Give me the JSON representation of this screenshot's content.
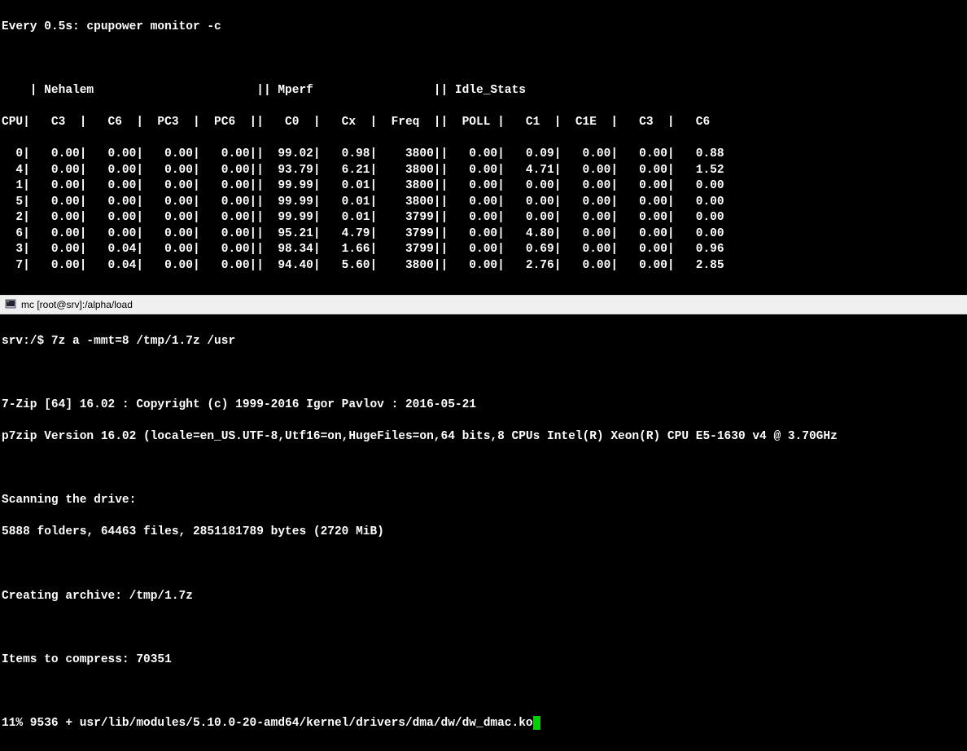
{
  "top": {
    "watch_line": "Every 0.5s: cpupower monitor -c",
    "groups": [
      "Nehalem",
      "Mperf",
      "Idle_Stats"
    ],
    "headers": [
      "CPU",
      "C3",
      "C6",
      "PC3",
      "PC6",
      "C0",
      "Cx",
      "Freq",
      "POLL",
      "C1",
      "C1E",
      "C3",
      "C6"
    ],
    "rows": [
      {
        "cpu": "0",
        "c3": "0.00",
        "c6": "0.00",
        "pc3": "0.00",
        "pc6": "0.00",
        "c0": "99.02",
        "cx": "0.98",
        "freq": "3800",
        "poll": "0.00",
        "c1": "0.09",
        "c1e": "0.00",
        "ic3": "0.00",
        "ic6": "0.88"
      },
      {
        "cpu": "4",
        "c3": "0.00",
        "c6": "0.00",
        "pc3": "0.00",
        "pc6": "0.00",
        "c0": "93.79",
        "cx": "6.21",
        "freq": "3800",
        "poll": "0.00",
        "c1": "4.71",
        "c1e": "0.00",
        "ic3": "0.00",
        "ic6": "1.52"
      },
      {
        "cpu": "1",
        "c3": "0.00",
        "c6": "0.00",
        "pc3": "0.00",
        "pc6": "0.00",
        "c0": "99.99",
        "cx": "0.01",
        "freq": "3800",
        "poll": "0.00",
        "c1": "0.00",
        "c1e": "0.00",
        "ic3": "0.00",
        "ic6": "0.00"
      },
      {
        "cpu": "5",
        "c3": "0.00",
        "c6": "0.00",
        "pc3": "0.00",
        "pc6": "0.00",
        "c0": "99.99",
        "cx": "0.01",
        "freq": "3800",
        "poll": "0.00",
        "c1": "0.00",
        "c1e": "0.00",
        "ic3": "0.00",
        "ic6": "0.00"
      },
      {
        "cpu": "2",
        "c3": "0.00",
        "c6": "0.00",
        "pc3": "0.00",
        "pc6": "0.00",
        "c0": "99.99",
        "cx": "0.01",
        "freq": "3799",
        "poll": "0.00",
        "c1": "0.00",
        "c1e": "0.00",
        "ic3": "0.00",
        "ic6": "0.00"
      },
      {
        "cpu": "6",
        "c3": "0.00",
        "c6": "0.00",
        "pc3": "0.00",
        "pc6": "0.00",
        "c0": "95.21",
        "cx": "4.79",
        "freq": "3799",
        "poll": "0.00",
        "c1": "4.80",
        "c1e": "0.00",
        "ic3": "0.00",
        "ic6": "0.00"
      },
      {
        "cpu": "3",
        "c3": "0.00",
        "c6": "0.04",
        "pc3": "0.00",
        "pc6": "0.00",
        "c0": "98.34",
        "cx": "1.66",
        "freq": "3799",
        "poll": "0.00",
        "c1": "0.69",
        "c1e": "0.00",
        "ic3": "0.00",
        "ic6": "0.96"
      },
      {
        "cpu": "7",
        "c3": "0.00",
        "c6": "0.04",
        "pc3": "0.00",
        "pc6": "0.00",
        "c0": "94.40",
        "cx": "5.60",
        "freq": "3800",
        "poll": "0.00",
        "c1": "2.76",
        "c1e": "0.00",
        "ic3": "0.00",
        "ic6": "2.85"
      }
    ]
  },
  "titlebar": {
    "text": "mc [root@srv]:/alpha/load"
  },
  "bottom": {
    "cmd": "srv:/$ 7z a -mmt=8 /tmp/1.7z /usr",
    "line1": "7-Zip [64] 16.02 : Copyright (c) 1999-2016 Igor Pavlov : 2016-05-21",
    "line2": "p7zip Version 16.02 (locale=en_US.UTF-8,Utf16=on,HugeFiles=on,64 bits,8 CPUs Intel(R) Xeon(R) CPU E5-1630 v4 @ 3.70GHz",
    "scan": "Scanning the drive:",
    "stats": "5888 folders, 64463 files, 2851181789 bytes (2720 MiB)",
    "create": "Creating archive: /tmp/1.7z",
    "items": "Items to compress: 70351",
    "progress": "11% 9536 + usr/lib/modules/5.10.0-20-amd64/kernel/drivers/dma/dw/dw_dmac.ko"
  }
}
